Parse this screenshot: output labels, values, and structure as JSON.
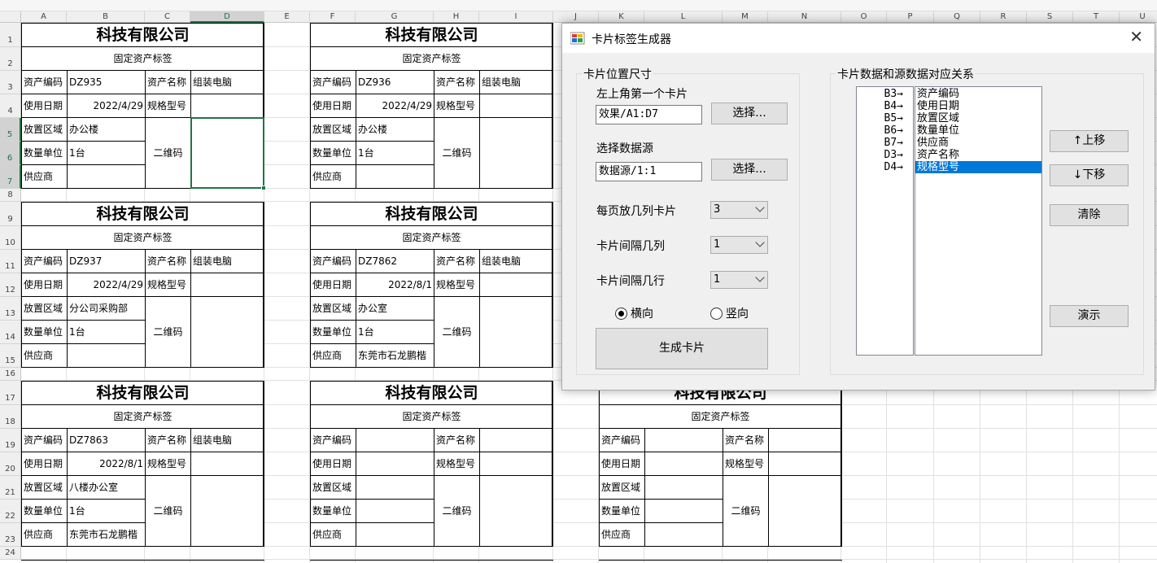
{
  "sheet": {
    "columns": [
      "A",
      "B",
      "C",
      "D",
      "E",
      "F",
      "G",
      "H",
      "I",
      "J",
      "K",
      "L",
      "M",
      "N",
      "O",
      "P",
      "Q",
      "R",
      "S",
      "T",
      "U"
    ],
    "selected_column": "D",
    "rows": [
      "1",
      "2",
      "3",
      "4",
      "5",
      "6",
      "7",
      "8",
      "9",
      "10",
      "11",
      "12",
      "13",
      "14",
      "15",
      "16",
      "17",
      "18",
      "19",
      "20",
      "21",
      "22",
      "23",
      "24"
    ],
    "selected_rows": [
      "5",
      "6",
      "7"
    ],
    "cards": [
      {
        "title": "科技有限公司",
        "subtitle": "固定资产标签",
        "code_label": "资产编码",
        "code": "DZ935",
        "name_label": "资产名称",
        "name": "组装电脑",
        "date_label": "使用日期",
        "date": "2022/4/29",
        "model_label": "规格型号",
        "model": "",
        "area_label": "放置区域",
        "area": "办公楼",
        "unit_label": "数量单位",
        "unit": "1台",
        "qr_label": "二维码",
        "supplier_label": "供应商",
        "supplier": ""
      },
      {
        "title": "科技有限公司",
        "subtitle": "固定资产标签",
        "code_label": "资产编码",
        "code": "DZ936",
        "name_label": "资产名称",
        "name": "组装电脑",
        "date_label": "使用日期",
        "date": "2022/4/29",
        "model_label": "规格型号",
        "model": "",
        "area_label": "放置区域",
        "area": "办公楼",
        "unit_label": "数量单位",
        "unit": "1台",
        "qr_label": "二维码",
        "supplier_label": "供应商",
        "supplier": ""
      },
      {
        "title": "科技有限公司",
        "subtitle": "固定资产标签",
        "code_label": "资产编码",
        "code": "DZ937",
        "name_label": "资产名称",
        "name": "组装电脑",
        "date_label": "使用日期",
        "date": "2022/4/29",
        "model_label": "规格型号",
        "model": "",
        "area_label": "放置区域",
        "area": "分公司采购部",
        "unit_label": "数量单位",
        "unit": "1台",
        "qr_label": "二维码",
        "supplier_label": "供应商",
        "supplier": ""
      },
      {
        "title": "科技有限公司",
        "subtitle": "固定资产标签",
        "code_label": "资产编码",
        "code": "DZ7862",
        "name_label": "资产名称",
        "name": "组装电脑",
        "date_label": "使用日期",
        "date": "2022/8/1",
        "model_label": "规格型号",
        "model": "",
        "area_label": "放置区域",
        "area": "办公室",
        "unit_label": "数量单位",
        "unit": "1台",
        "qr_label": "二维码",
        "supplier_label": "供应商",
        "supplier": "东莞市石龙鹏楷"
      },
      {
        "title": "科技有限公司",
        "subtitle": "固定资产标签",
        "code_label": "资产编码",
        "code": "DZ7863",
        "name_label": "资产名称",
        "name": "组装电脑",
        "date_label": "使用日期",
        "date": "2022/8/1",
        "model_label": "规格型号",
        "model": "",
        "area_label": "放置区域",
        "area": "八楼办公室",
        "unit_label": "数量单位",
        "unit": "1台",
        "qr_label": "二维码",
        "supplier_label": "供应商",
        "supplier": "东莞市石龙鹏楷"
      },
      {
        "title": "科技有限公司",
        "subtitle": "固定资产标签",
        "code_label": "资产编码",
        "code": "",
        "name_label": "资产名称",
        "name": "",
        "date_label": "使用日期",
        "date": "",
        "model_label": "规格型号",
        "model": "",
        "area_label": "放置区域",
        "area": "",
        "unit_label": "数量单位",
        "unit": "",
        "qr_label": "二维码",
        "supplier_label": "供应商",
        "supplier": ""
      },
      {
        "title": "科技有限公司",
        "subtitle": "固定资产标签",
        "code_label": "资产编码",
        "code": "",
        "name_label": "资产名称",
        "name": "",
        "date_label": "使用日期",
        "date": "",
        "model_label": "规格型号",
        "model": "",
        "area_label": "放置区域",
        "area": "",
        "unit_label": "数量单位",
        "unit": "",
        "qr_label": "二维码",
        "supplier_label": "供应商",
        "supplier": ""
      }
    ]
  },
  "dialog": {
    "title": "卡片标签生成器",
    "close_icon": "close-icon",
    "position_group": {
      "label": "卡片位置尺寸",
      "first_card_label": "左上角第一个卡片",
      "first_card_value": "效果/A1:D7",
      "select_button_1": "选择...",
      "data_source_label": "选择数据源",
      "data_source_value": "数据源/1:1",
      "select_button_2": "选择...",
      "columns_per_page_label": "每页放几列卡片",
      "columns_per_page_value": "3",
      "col_gap_label": "卡片间隔几列",
      "col_gap_value": "1",
      "row_gap_label": "卡片间隔几行",
      "row_gap_value": "1",
      "horizontal_label": "横向",
      "vertical_label": "竖向",
      "orientation_selected": "横向",
      "generate_button": "生成卡片"
    },
    "mapping_group": {
      "label": "卡片数据和源数据对应关系",
      "targets": [
        "B3→",
        "B4→",
        "B5→",
        "B6→",
        "B7→",
        "D3→",
        "D4→"
      ],
      "fields": [
        "资产编码",
        "使用日期",
        "放置区域",
        "数量单位",
        "供应商",
        "资产名称",
        "规格型号"
      ],
      "selected_field": "规格型号",
      "move_up_button": "↑上移",
      "move_down_button": "↓下移",
      "clear_button": "清除",
      "demo_button": "演示"
    },
    "colors": {
      "accent": "#0078d7",
      "excel_green": "#217346"
    }
  }
}
